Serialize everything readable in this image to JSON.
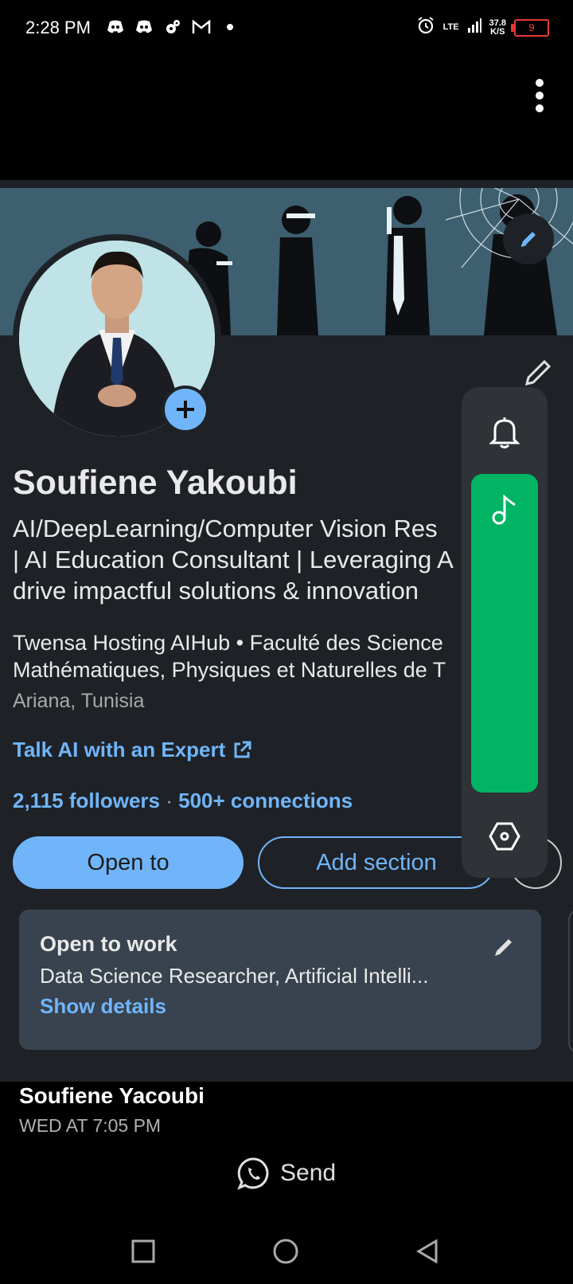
{
  "status_bar": {
    "time": "2:28 PM",
    "net_type": "LTE",
    "net_speed": "37.8",
    "net_speed_unit": "K/S",
    "battery": "9",
    "notification_icons": [
      "discord-icon",
      "discord-icon",
      "settings-icon",
      "gmail-icon",
      "dot-icon"
    ]
  },
  "profile": {
    "name": "Soufiene Yakoubi",
    "headline_lines": [
      "AI/DeepLearning/Computer Vision Res",
      "| AI Education Consultant | Leveraging A",
      "drive impactful solutions & innovation"
    ],
    "company_lines": [
      "Twensa Hosting AIHub • Faculté des Science",
      "Mathématiques, Physiques et Naturelles de T"
    ],
    "location": "Ariana, Tunisia",
    "link": "Talk AI with an Expert",
    "followers": "2,115 followers",
    "separator": "·",
    "connections": "500+ connections",
    "open_to_button": "Open to",
    "add_section_button": "Add section"
  },
  "open_to_work": {
    "title": "Open to work",
    "text": "Data Science Researcher, Artificial Intelli...",
    "link": "Show details"
  },
  "message": {
    "sender": "Soufiene Yacoubi",
    "timestamp": "WED AT 7:05 PM",
    "send_label": "Send"
  },
  "colors": {
    "accent": "#70b5f9",
    "card": "#1e2227",
    "panel_green": "#00b464",
    "battery_low": "#e53935"
  }
}
